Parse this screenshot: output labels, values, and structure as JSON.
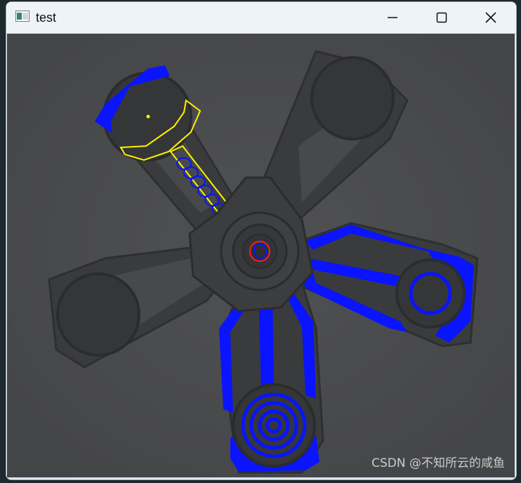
{
  "window": {
    "title": "test",
    "icon": "app-window-icon",
    "controls": {
      "minimize": "minimize-icon",
      "maximize": "maximize-icon",
      "close": "close-icon"
    }
  },
  "canvas": {
    "description_icons": [
      "wheel-hub",
      "spoke-arm",
      "blue-highlight-outline",
      "yellow-contour"
    ],
    "watermark": "CSDN @不知所云的咸鱼",
    "colors": {
      "background": "#4a4b4d",
      "part_fill": "#3c3d3f",
      "blue_highlight": "#0a14ff",
      "yellow_contour": "#fff200",
      "red_contour": "#ff1e1e"
    }
  }
}
